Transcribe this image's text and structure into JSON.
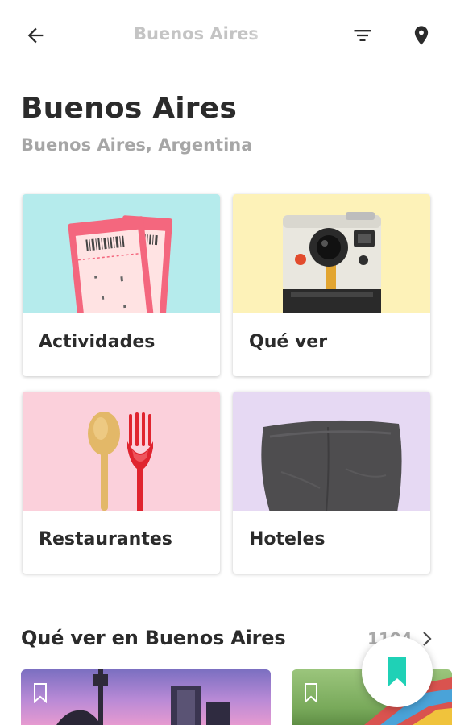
{
  "topbar": {
    "back_icon": "arrow-left-icon",
    "title": "Buenos Aires",
    "filter_icon": "filter-lines-icon",
    "location_icon": "map-pin-icon"
  },
  "header": {
    "title": "Buenos Aires",
    "subtitle": "Buenos Aires, Argentina"
  },
  "categories": [
    {
      "label": "Actividades",
      "icon": "tickets-illustration",
      "bg": "#b5ebec"
    },
    {
      "label": "Qué ver",
      "icon": "camera-illustration",
      "bg": "#fdf2b8"
    },
    {
      "label": "Restaurantes",
      "icon": "cutlery-illustration",
      "bg": "#fbd0db"
    },
    {
      "label": "Hoteles",
      "icon": "pillow-illustration",
      "bg": "#e6d9f3"
    }
  ],
  "section": {
    "title": "Qué ver en Buenos Aires",
    "count": "1104",
    "chevron_icon": "chevron-right-icon"
  },
  "places": [
    {
      "bookmark_icon": "bookmark-outline-icon"
    },
    {
      "bookmark_icon": "bookmark-outline-icon"
    }
  ],
  "fab": {
    "icon": "bookmark-icon",
    "color": "#1fd1b6"
  }
}
